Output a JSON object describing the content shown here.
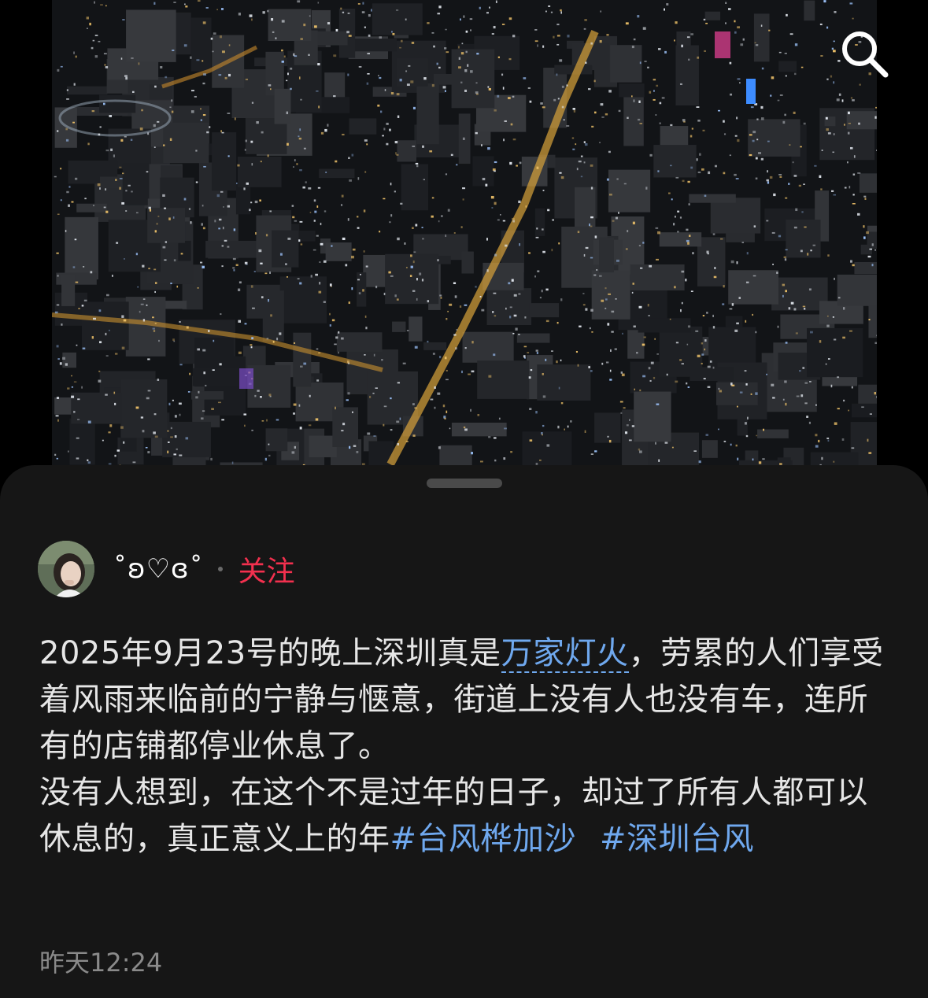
{
  "author": {
    "name": "˚ʚ♡ɞ˚",
    "follow_label": "关注"
  },
  "post": {
    "line1_before_link": "2025年9月23号的晚上深圳真是",
    "link_text": "万家灯火",
    "line1_after_link": "，劳累的人们享受着风雨来临前的宁静与惬意，街道上没有人也没有车，连所有的店铺都停业休息了。",
    "paragraph2": "没有人想到，在这个不是过年的日子，却过了所有人都可以休息的，真正意义上的年",
    "hashtags": [
      "#台风桦加沙",
      "#深圳台风"
    ],
    "timestamp": "昨天12:24"
  },
  "icons": {
    "search": "search-icon",
    "avatar": "avatar-image"
  }
}
